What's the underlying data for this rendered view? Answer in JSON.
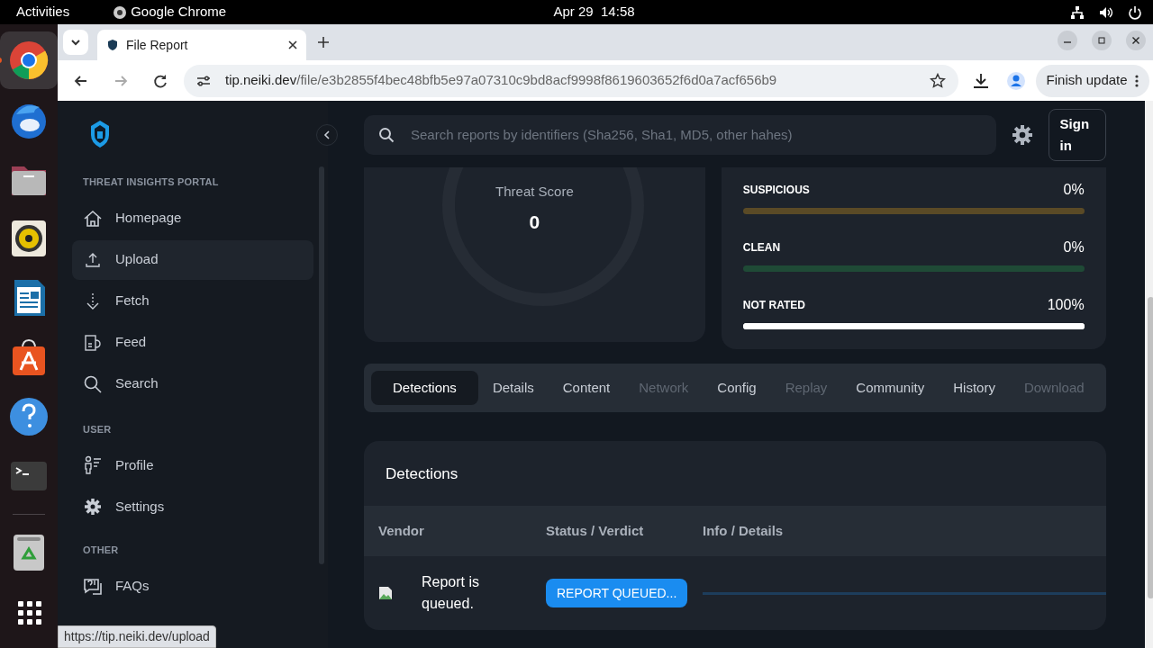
{
  "top_bar": {
    "activities": "Activities",
    "app": "Google Chrome",
    "clock": "Apr 29  14:58"
  },
  "dock": [
    {
      "kind": "chrome",
      "active": true
    },
    {
      "kind": "mail",
      "active": false
    },
    {
      "kind": "folder",
      "active": false
    },
    {
      "kind": "speaker",
      "active": false
    },
    {
      "kind": "document",
      "active": false
    },
    {
      "kind": "store",
      "active": false
    },
    {
      "kind": "help",
      "active": false
    },
    {
      "kind": "terminal",
      "active": false
    },
    {
      "kind": "trash",
      "active": false
    },
    {
      "kind": "grid",
      "active": false
    }
  ],
  "browser": {
    "tab_title": "File Report",
    "url_host": "tip.neiki.dev",
    "url_path": "/file/e3b2855f4bec48bfb5e97a07310c9bd8acf9998f8619603652f6d0a7acf656b9",
    "update_button": "Finish update",
    "status_url": "https://tip.neiki.dev/upload"
  },
  "sidebar": {
    "sections": [
      {
        "heading": "THREAT INSIGHTS PORTAL",
        "items": [
          {
            "label": "Homepage",
            "kind": "home",
            "selected": false
          },
          {
            "label": "Upload",
            "kind": "upload",
            "selected": true
          },
          {
            "label": "Fetch",
            "kind": "fetch",
            "selected": false
          },
          {
            "label": "Feed",
            "kind": "feed",
            "selected": false
          },
          {
            "label": "Search",
            "kind": "search",
            "selected": false
          }
        ]
      },
      {
        "heading": "USER",
        "items": [
          {
            "label": "Profile",
            "kind": "profile",
            "selected": false
          },
          {
            "label": "Settings",
            "kind": "settings",
            "selected": false
          }
        ]
      },
      {
        "heading": "OTHER",
        "items": [
          {
            "label": "FAQs",
            "kind": "faq",
            "selected": false
          }
        ]
      }
    ]
  },
  "search": {
    "placeholder": "Search reports by identifiers (Sha256, Sha1, MD5, other hahes)"
  },
  "sign_in": "Sign in",
  "threat_score": {
    "label": "Threat Score",
    "value": "0"
  },
  "ratings": [
    {
      "label": "SUSPICIOUS",
      "reading": "0%",
      "level": 0,
      "color": "#5a4a26"
    },
    {
      "label": "CLEAN",
      "reading": "0%",
      "level": 0,
      "color": "#1f4a36"
    },
    {
      "label": "NOT RATED",
      "reading": "100%",
      "level": 1,
      "color": "#ffffff"
    }
  ],
  "tabs": [
    {
      "label": "Detections",
      "selected": true,
      "disabled": false
    },
    {
      "label": "Details",
      "selected": false,
      "disabled": false
    },
    {
      "label": "Content",
      "selected": false,
      "disabled": false
    },
    {
      "label": "Network",
      "selected": false,
      "disabled": true
    },
    {
      "label": "Config",
      "selected": false,
      "disabled": false
    },
    {
      "label": "Replay",
      "selected": false,
      "disabled": true
    },
    {
      "label": "Community",
      "selected": false,
      "disabled": false
    },
    {
      "label": "History",
      "selected": false,
      "disabled": false
    },
    {
      "label": "Download",
      "selected": false,
      "disabled": true
    }
  ],
  "detections": {
    "title": "Detections",
    "columns": [
      "Vendor",
      "Status / Verdict",
      "Info / Details"
    ],
    "rows": [
      {
        "vendor": "Report is queued.",
        "status": "REPORT QUEUED..."
      }
    ]
  }
}
